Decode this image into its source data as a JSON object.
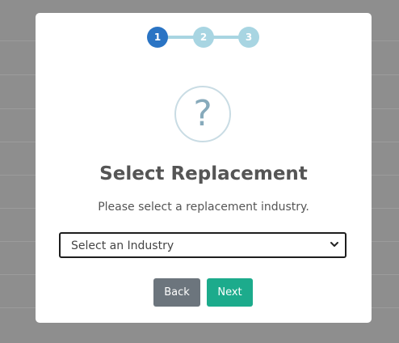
{
  "modal": {
    "steps": [
      "1",
      "2",
      "3"
    ],
    "active_step": 1,
    "icon": "question-circle-icon",
    "question_glyph": "?",
    "title": "Select Replacement",
    "subtitle": "Please select a replacement industry.",
    "industry_select": {
      "selected": "Select an Industry"
    },
    "back_label": "Back",
    "next_label": "Next"
  },
  "colors": {
    "step_active": "#2a74c4",
    "step_inactive": "#a8d5e2",
    "back_button": "#6c757d",
    "next_button": "#1cab8c",
    "overlay": "#8e8e8e"
  }
}
